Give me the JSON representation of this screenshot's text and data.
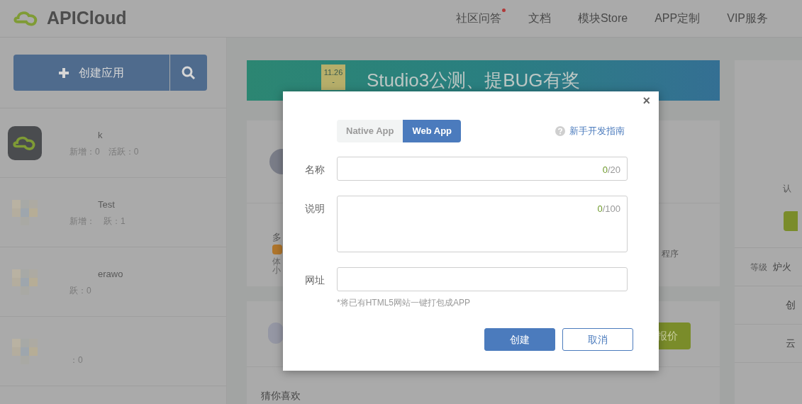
{
  "header": {
    "logo": "APICloud",
    "nav": [
      {
        "label": "社区问答",
        "badge": true
      },
      {
        "label": "文档",
        "badge": false
      },
      {
        "label": "模块Store",
        "badge": false
      },
      {
        "label": "APP定制",
        "badge": false
      },
      {
        "label": "VIP服务",
        "badge": false
      }
    ]
  },
  "sidebar": {
    "create_button": "创建应用",
    "apps": [
      {
        "title": "k",
        "stats": [
          "新增：0",
          "活跃：0"
        ],
        "kind": "logo"
      },
      {
        "title": "Test",
        "stats": [
          "新增：",
          "跃：1"
        ],
        "kind": "mosaic"
      },
      {
        "title": "erawo",
        "stats": [
          "跃：0"
        ],
        "kind": "mosaic"
      },
      {
        "stats": [
          "：0"
        ],
        "kind": "mosaic"
      }
    ]
  },
  "main": {
    "banner": {
      "dates": [
        "11.26",
        "-"
      ],
      "text": "Studio3公测、提BUG有奖"
    },
    "card_texts": [
      "多",
      "体",
      "小"
    ],
    "card_right_text": "程序",
    "quote_button": "报价",
    "section_title": "猜你喜欢"
  },
  "right_panel": {
    "cert_text": "认",
    "level_label": "等级",
    "level_value": "炉火",
    "rows": [
      "创",
      "云"
    ]
  },
  "dialog": {
    "close": "×",
    "tabs": [
      {
        "label": "Native App",
        "selected": false
      },
      {
        "label": "Web App",
        "selected": true
      }
    ],
    "help_link": "新手开发指南",
    "fields": [
      {
        "label": "名称",
        "kind": "input",
        "count": "0",
        "max": "/20"
      },
      {
        "label": "说明",
        "kind": "textarea",
        "count": "0",
        "max": "/100"
      },
      {
        "label": "网址",
        "kind": "input",
        "hint": "*将已有HTML5网站一键打包成APP"
      }
    ],
    "buttons": [
      {
        "label": "创建",
        "kind": "primary"
      },
      {
        "label": "取消",
        "kind": "secondary"
      }
    ]
  }
}
